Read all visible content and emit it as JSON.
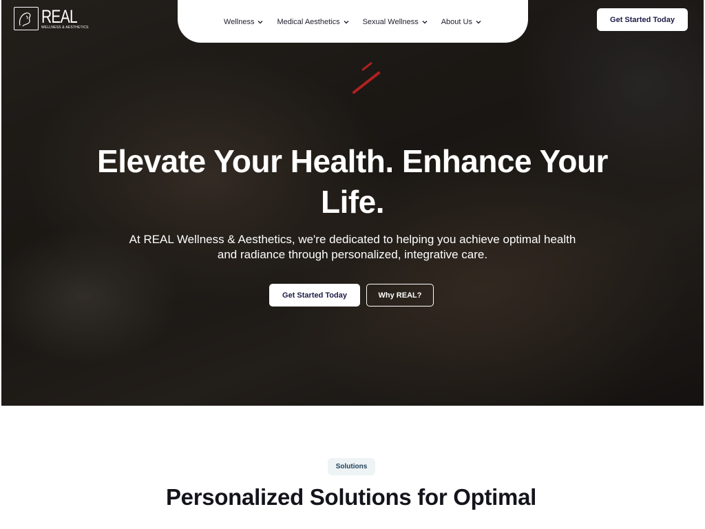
{
  "brand": {
    "name": "REAL",
    "tagline": "WELLNESS & AESTHETICS"
  },
  "nav": {
    "items": [
      {
        "label": "Wellness",
        "icon": "chevron-down-icon"
      },
      {
        "label": "Medical Aesthetics",
        "icon": "chevron-down-icon"
      },
      {
        "label": "Sexual Wellness",
        "icon": "chevron-down-icon"
      },
      {
        "label": "About Us",
        "icon": "chevron-down-icon"
      }
    ],
    "cta_label": "Get Started Today"
  },
  "hero": {
    "headline": "Elevate Your Health. Enhance Your Life.",
    "subtext": "At REAL Wellness & Aesthetics, we're dedicated to helping you achieve optimal health and radiance through personalized, integrative care.",
    "primary_button": "Get Started Today",
    "secondary_button": "Why REAL?"
  },
  "solutions": {
    "badge": "Solutions",
    "title": "Personalized Solutions for Optimal"
  },
  "colors": {
    "navy_text": "#1c1b47",
    "badge_bg": "#eef3f5",
    "hero_overlay": "#1e1a17"
  }
}
